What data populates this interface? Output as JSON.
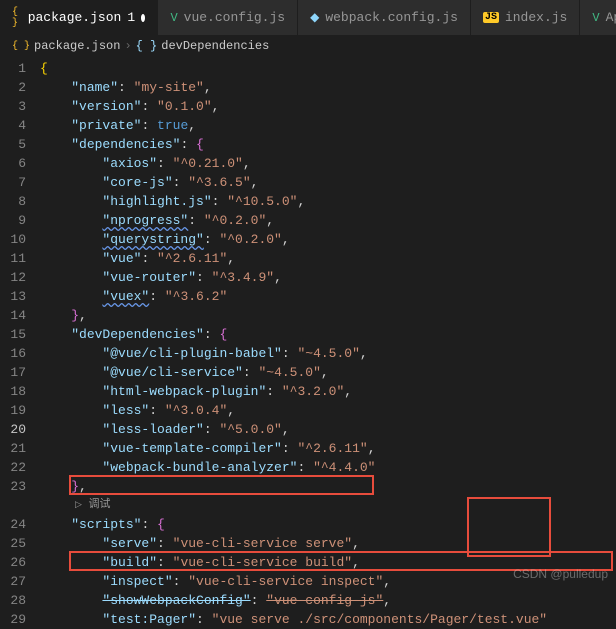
{
  "tabs": [
    {
      "label": "package.json",
      "dirty": "1",
      "icon": "json",
      "active": true
    },
    {
      "label": "vue.config.js",
      "icon": "vue"
    },
    {
      "label": "webpack.config.js",
      "icon": "webpack"
    },
    {
      "label": "index.js",
      "icon": "js"
    },
    {
      "label": "App.vue",
      "icon": "vue"
    }
  ],
  "breadcrumb": {
    "file": "package.json",
    "symbol_brace": "{ }",
    "symbol": "devDependencies"
  },
  "codelens": {
    "label": "调试"
  },
  "gutter": [
    "1",
    "2",
    "3",
    "4",
    "5",
    "6",
    "7",
    "8",
    "9",
    "10",
    "11",
    "12",
    "13",
    "14",
    "15",
    "16",
    "17",
    "18",
    "19",
    "20",
    "21",
    "22",
    "23",
    "",
    "24",
    "25",
    "26",
    "27",
    "28",
    "29"
  ],
  "current_line": "20",
  "json": {
    "name": {
      "k": "name",
      "v": "my-site"
    },
    "version": {
      "k": "version",
      "v": "0.1.0"
    },
    "private": {
      "k": "private",
      "v": "true"
    },
    "dependencies": {
      "k": "dependencies",
      "items": [
        {
          "k": "axios",
          "v": "^0.21.0"
        },
        {
          "k": "core-js",
          "v": "^3.6.5"
        },
        {
          "k": "highlight.js",
          "v": "^10.5.0"
        },
        {
          "k": "nprogress",
          "v": "^0.2.0",
          "warn": true
        },
        {
          "k": "querystring",
          "v": "^0.2.0",
          "warn": true
        },
        {
          "k": "vue",
          "v": "^2.6.11"
        },
        {
          "k": "vue-router",
          "v": "^3.4.9"
        },
        {
          "k": "vuex",
          "v": "^3.6.2",
          "warn": true
        }
      ]
    },
    "devDependencies": {
      "k": "devDependencies",
      "items": [
        {
          "k": "@vue/cli-plugin-babel",
          "v": "~4.5.0"
        },
        {
          "k": "@vue/cli-service",
          "v": "~4.5.0"
        },
        {
          "k": "html-webpack-plugin",
          "v": "^3.2.0"
        },
        {
          "k": "less",
          "v": "^3.0.4"
        },
        {
          "k": "less-loader",
          "v": "^5.0.0"
        },
        {
          "k": "vue-template-compiler",
          "v": "^2.6.11"
        },
        {
          "k": "webpack-bundle-analyzer",
          "v": "^4.4.0"
        }
      ]
    },
    "scripts": {
      "k": "scripts",
      "items": [
        {
          "k": "serve",
          "v": "vue-cli-service serve"
        },
        {
          "k": "build",
          "v": "vue-cli-service build"
        },
        {
          "k": "inspect",
          "v": "vue-cli-service inspect"
        },
        {
          "k": "showWebpackConfig",
          "v": "vue-config-js",
          "strike": true
        },
        {
          "k": "test:Pager",
          "v": "vue serve ./src/components/Pager/test.vue"
        }
      ]
    }
  },
  "watermark": "CSDN @pulledup"
}
